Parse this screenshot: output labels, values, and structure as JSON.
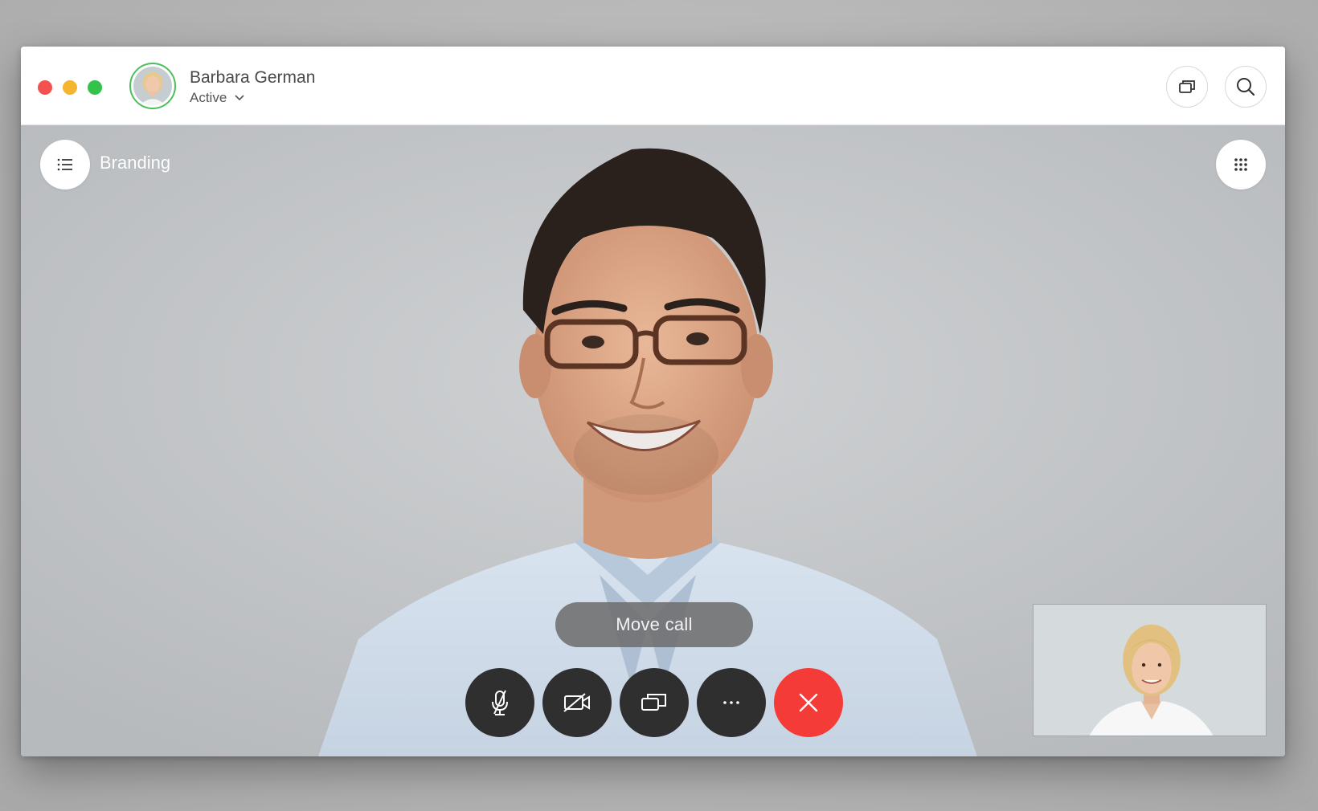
{
  "header": {
    "user_name": "Barbara German",
    "status": "Active"
  },
  "space": {
    "name": "Branding"
  },
  "call": {
    "tooltip": "Move call",
    "controls": [
      {
        "name": "mute-microphone",
        "icon": "microphone-muted-icon"
      },
      {
        "name": "stop-video",
        "icon": "camera-off-icon"
      },
      {
        "name": "share-screen",
        "icon": "share-screen-icon"
      },
      {
        "name": "more",
        "icon": "ellipsis-icon"
      },
      {
        "name": "end-call",
        "icon": "close-icon"
      }
    ]
  },
  "colors": {
    "close": "#f25350",
    "minimize": "#f5b52e",
    "maximize": "#33c24a",
    "presence": "#4bbf5a",
    "end_call": "#f53b37",
    "control_bg": "#2f2f2f"
  }
}
